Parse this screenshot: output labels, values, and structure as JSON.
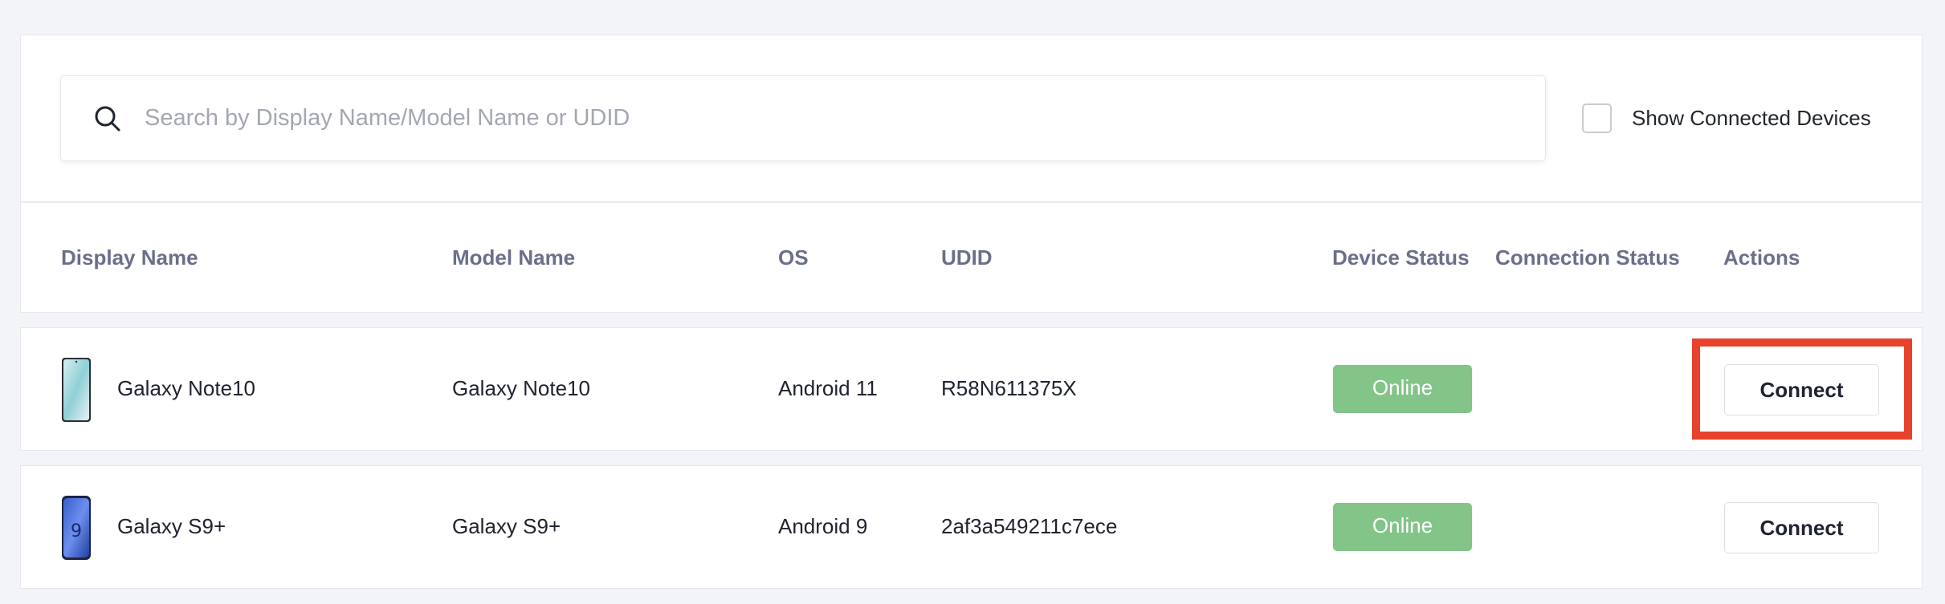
{
  "search": {
    "placeholder": "Search by Display Name/Model Name or UDID",
    "value": ""
  },
  "filter": {
    "show_connected_label": "Show Connected Devices",
    "checked": false
  },
  "table": {
    "columns": {
      "display_name": "Display Name",
      "model_name": "Model Name",
      "os": "OS",
      "udid": "UDID",
      "device_status": "Device Status",
      "connection_status": "Connection Status",
      "actions": "Actions"
    },
    "rows": [
      {
        "display_name": "Galaxy Note10",
        "model_name": "Galaxy Note10",
        "os": "Android 11",
        "udid": "R58N611375X",
        "device_status": "Online",
        "connection_status": "",
        "action_label": "Connect",
        "thumb_icon": "phone-thumbnail-icon"
      },
      {
        "display_name": "Galaxy S9+",
        "model_name": "Galaxy S9+",
        "os": "Android 9",
        "udid": "2af3a549211c7ece",
        "device_status": "Online",
        "connection_status": "",
        "action_label": "Connect",
        "thumb_icon": "phone-thumbnail-icon"
      }
    ]
  },
  "colors": {
    "online_badge": "#83c489",
    "highlight": "#e8412c",
    "header_text": "#6b6f8a"
  }
}
